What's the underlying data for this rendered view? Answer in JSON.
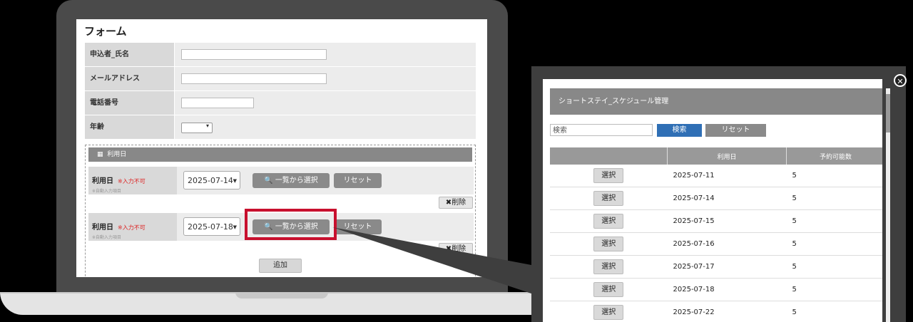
{
  "form": {
    "title": "フォーム",
    "fields": [
      {
        "label": "申込者_氏名"
      },
      {
        "label": "メールアドレス"
      },
      {
        "label": "電話番号"
      },
      {
        "label": "年齢"
      }
    ],
    "section_title": "利用日",
    "usage_rows": [
      {
        "label": "利用日",
        "required_note": "※入力不可",
        "sub_note": "※自動入力項目",
        "date": "2025-07-14",
        "list_button": "一覧から選択",
        "reset_button": "リセット",
        "delete_button": "削除"
      },
      {
        "label": "利用日",
        "required_note": "※入力不可",
        "sub_note": "※自動入力項目",
        "date": "2025-07-18",
        "list_button": "一覧から選択",
        "reset_button": "リセット",
        "delete_button": "削除"
      }
    ],
    "add_button": "追加"
  },
  "modal": {
    "title": "ショートステイ_スケジュール管理",
    "search_placeholder": "検索",
    "search_button": "検索",
    "reset_button": "リセット",
    "columns": [
      "",
      "利用日",
      "予約可能数"
    ],
    "select_label": "選択",
    "rows": [
      {
        "date": "2025-07-11",
        "available": "5"
      },
      {
        "date": "2025-07-14",
        "available": "5"
      },
      {
        "date": "2025-07-15",
        "available": "5"
      },
      {
        "date": "2025-07-16",
        "available": "5"
      },
      {
        "date": "2025-07-17",
        "available": "5"
      },
      {
        "date": "2025-07-18",
        "available": "5"
      },
      {
        "date": "2025-07-22",
        "available": "5"
      }
    ]
  },
  "colors": {
    "highlight": "#c8102e",
    "search_button": "#2f6fb5",
    "gray_button": "#8a8a8a"
  }
}
